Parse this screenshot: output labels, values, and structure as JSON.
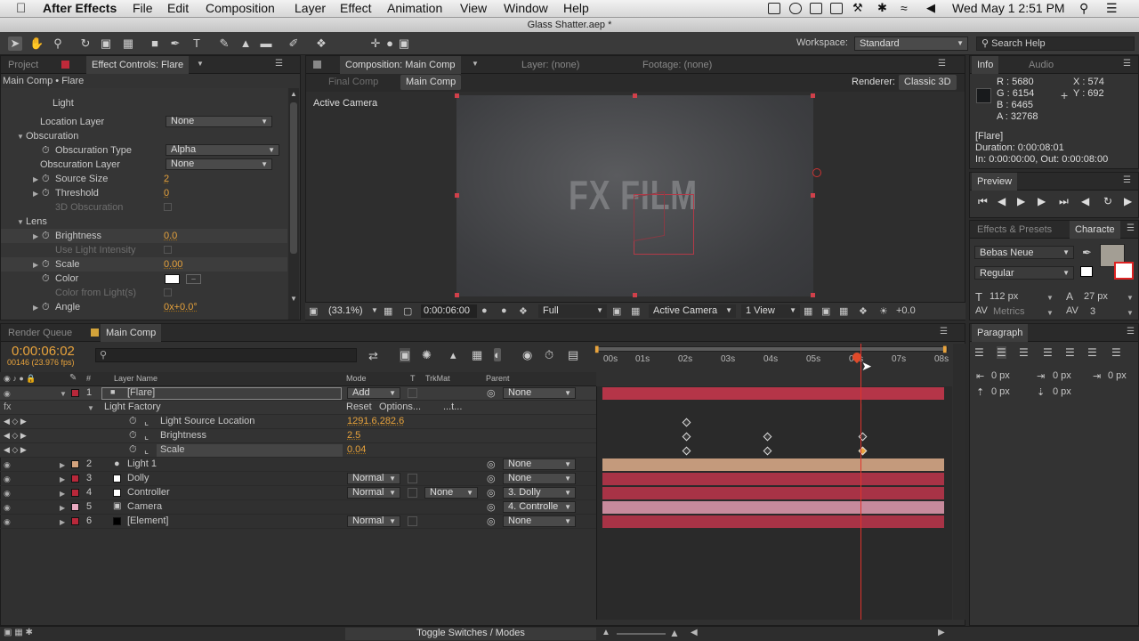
{
  "menubar": {
    "app": "After Effects",
    "items": [
      "File",
      "Edit",
      "Composition",
      "Layer",
      "Effect",
      "Animation",
      "View",
      "Window",
      "Help"
    ],
    "clock": "Wed May 1  2:51 PM"
  },
  "window_title": "Glass Shatter.aep *",
  "toolbar": {
    "workspace_label": "Workspace:",
    "workspace_value": "Standard",
    "search_placeholder": "Search Help"
  },
  "project_panel": {
    "tab_project": "Project",
    "tab_effect_controls": "Effect Controls: Flare",
    "breadcrumb": "Main Comp • Flare",
    "section_light": "Light",
    "location_layer_label": "Location Layer",
    "location_layer_value": "None",
    "obscuration_label": "Obscuration",
    "obscuration_type_label": "Obscuration Type",
    "obscuration_type_value": "Alpha",
    "obscuration_layer_label": "Obscuration Layer",
    "obscuration_layer_value": "None",
    "source_size_label": "Source Size",
    "source_size_value": "2",
    "threshold_label": "Threshold",
    "threshold_value": "0",
    "obscuration3d_label": "3D Obscuration",
    "lens_label": "Lens",
    "brightness_label": "Brightness",
    "brightness_value": "0.0",
    "use_light_intensity_label": "Use Light Intensity",
    "scale_label": "Scale",
    "scale_value": "0.00",
    "color_label": "Color",
    "color_from_lights_label": "Color from Light(s)",
    "angle_label": "Angle",
    "angle_value": "0x+0.0°"
  },
  "composition_panel": {
    "tab_label": "Composition: Main Comp",
    "tab_layer": "Layer: (none)",
    "tab_footage": "Footage: (none)",
    "subtab_final": "Final Comp",
    "subtab_main": "Main Comp",
    "renderer_label": "Renderer:",
    "renderer_value": "Classic 3D",
    "active_camera_overlay": "Active Camera",
    "canvas_text": "FX FILM",
    "zoom": "(33.1%)",
    "timecode": "0:00:06:00",
    "resolution": "Full",
    "view_camera": "Active Camera",
    "view_count": "1 View",
    "exposure": "+0.0"
  },
  "info_panel": {
    "tab_info": "Info",
    "tab_audio": "Audio",
    "r": "R : 5680",
    "g": "G : 6154",
    "b": "B : 6465",
    "a": "A : 32768",
    "x": "X : 574",
    "y": "Y : 692",
    "layer_name": "[Flare]",
    "duration": "Duration: 0:00:08:01",
    "in_out": "In: 0:00:00:00, Out: 0:00:08:00"
  },
  "preview_panel": {
    "title": "Preview"
  },
  "character_panel": {
    "tab_effects": "Effects & Presets",
    "tab_character": "Characte",
    "font": "Bebas Neue",
    "style": "Regular",
    "size": "112 px",
    "leading": "27 px",
    "kerning_label": "Metrics",
    "tracking": "3",
    "fill_color": "#a39e94"
  },
  "paragraph_panel": {
    "title": "Paragraph",
    "indent_left": "0 px",
    "indent_right": "0 px",
    "indent_first": "0 px",
    "space_before": "0 px",
    "space_after": "0 px"
  },
  "timeline": {
    "tab_render_queue": "Render Queue",
    "tab_main_comp": "Main Comp",
    "current_time": "0:00:06:02",
    "frame_info": "00146 (23.976 fps)",
    "col_layer_name": "Layer Name",
    "col_mode": "Mode",
    "col_t": "T",
    "col_trkmat": "TrkMat",
    "col_parent": "Parent",
    "ruler": [
      "00s",
      "01s",
      "02s",
      "03s",
      "04s",
      "05s",
      "06s",
      "07s",
      "08s"
    ],
    "effect_name": "Light Factory",
    "effect_reset": "Reset",
    "effect_options": "Options...",
    "effect_about": "...t...",
    "props": [
      {
        "name": "Light Source Location",
        "value": "1291.6,282.6"
      },
      {
        "name": "Brightness",
        "value": "2.5"
      },
      {
        "name": "Scale",
        "value": "0.04"
      }
    ],
    "layers": [
      {
        "num": "1",
        "name": "[Flare]",
        "mode": "Add",
        "trkmat": "",
        "parent": "None",
        "swatch": "#b8283a",
        "bar": "#b53548"
      },
      {
        "num": "2",
        "name": "Light 1",
        "mode": "",
        "trkmat": "",
        "parent": "None",
        "swatch": "#d4a37d",
        "bar": "#c49a7c"
      },
      {
        "num": "3",
        "name": "Dolly",
        "mode": "Normal",
        "trkmat": "",
        "parent": "None",
        "swatch": "#ffffff",
        "bar": "#a83346"
      },
      {
        "num": "4",
        "name": "Controller",
        "mode": "Normal",
        "trkmat": "None",
        "parent": "3. Dolly",
        "swatch": "#ffffff",
        "bar": "#a83346"
      },
      {
        "num": "5",
        "name": "Camera",
        "mode": "",
        "trkmat": "",
        "parent": "4. Controlle",
        "swatch": "#e8a9c0",
        "bar": "#c78a9c"
      },
      {
        "num": "6",
        "name": "[Element]",
        "mode": "Normal",
        "trkmat": "",
        "parent": "None",
        "swatch": "#000000",
        "bar": "#a83346"
      }
    ],
    "toggle_label": "Toggle Switches / Modes"
  }
}
